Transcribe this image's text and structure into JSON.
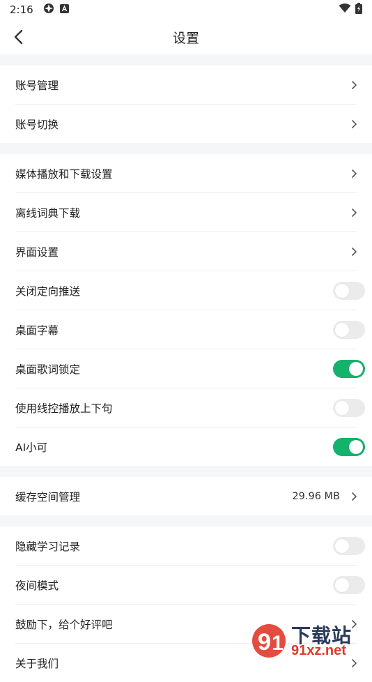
{
  "status_bar": {
    "time": "2:16"
  },
  "header": {
    "title": "设置"
  },
  "groups": [
    {
      "items": [
        {
          "label": "账号管理",
          "type": "nav"
        },
        {
          "label": "账号切换",
          "type": "nav"
        }
      ]
    },
    {
      "items": [
        {
          "label": "媒体播放和下载设置",
          "type": "nav"
        },
        {
          "label": "离线词典下载",
          "type": "nav"
        },
        {
          "label": "界面设置",
          "type": "nav"
        },
        {
          "label": "关闭定向推送",
          "type": "toggle",
          "on": false
        },
        {
          "label": "桌面字幕",
          "type": "toggle",
          "on": false
        },
        {
          "label": "桌面歌词锁定",
          "type": "toggle",
          "on": true
        },
        {
          "label": "使用线控播放上下句",
          "type": "toggle",
          "on": false
        },
        {
          "label": "AI小可",
          "type": "toggle",
          "on": true
        }
      ]
    },
    {
      "items": [
        {
          "label": "缓存空间管理",
          "type": "nav",
          "value": "29.96 MB"
        }
      ]
    },
    {
      "items": [
        {
          "label": "隐藏学习记录",
          "type": "toggle",
          "on": false
        },
        {
          "label": "夜间模式",
          "type": "toggle",
          "on": false
        },
        {
          "label": "鼓励下，给个好评吧",
          "type": "nav"
        },
        {
          "label": "关于我们",
          "type": "nav"
        }
      ]
    }
  ],
  "watermark": {
    "text": "下载站",
    "sub": "91xz.net"
  },
  "colors": {
    "toggle_on": "#14b26a",
    "toggle_off": "#ebebeb",
    "section_gap": "#f5f6f8"
  }
}
